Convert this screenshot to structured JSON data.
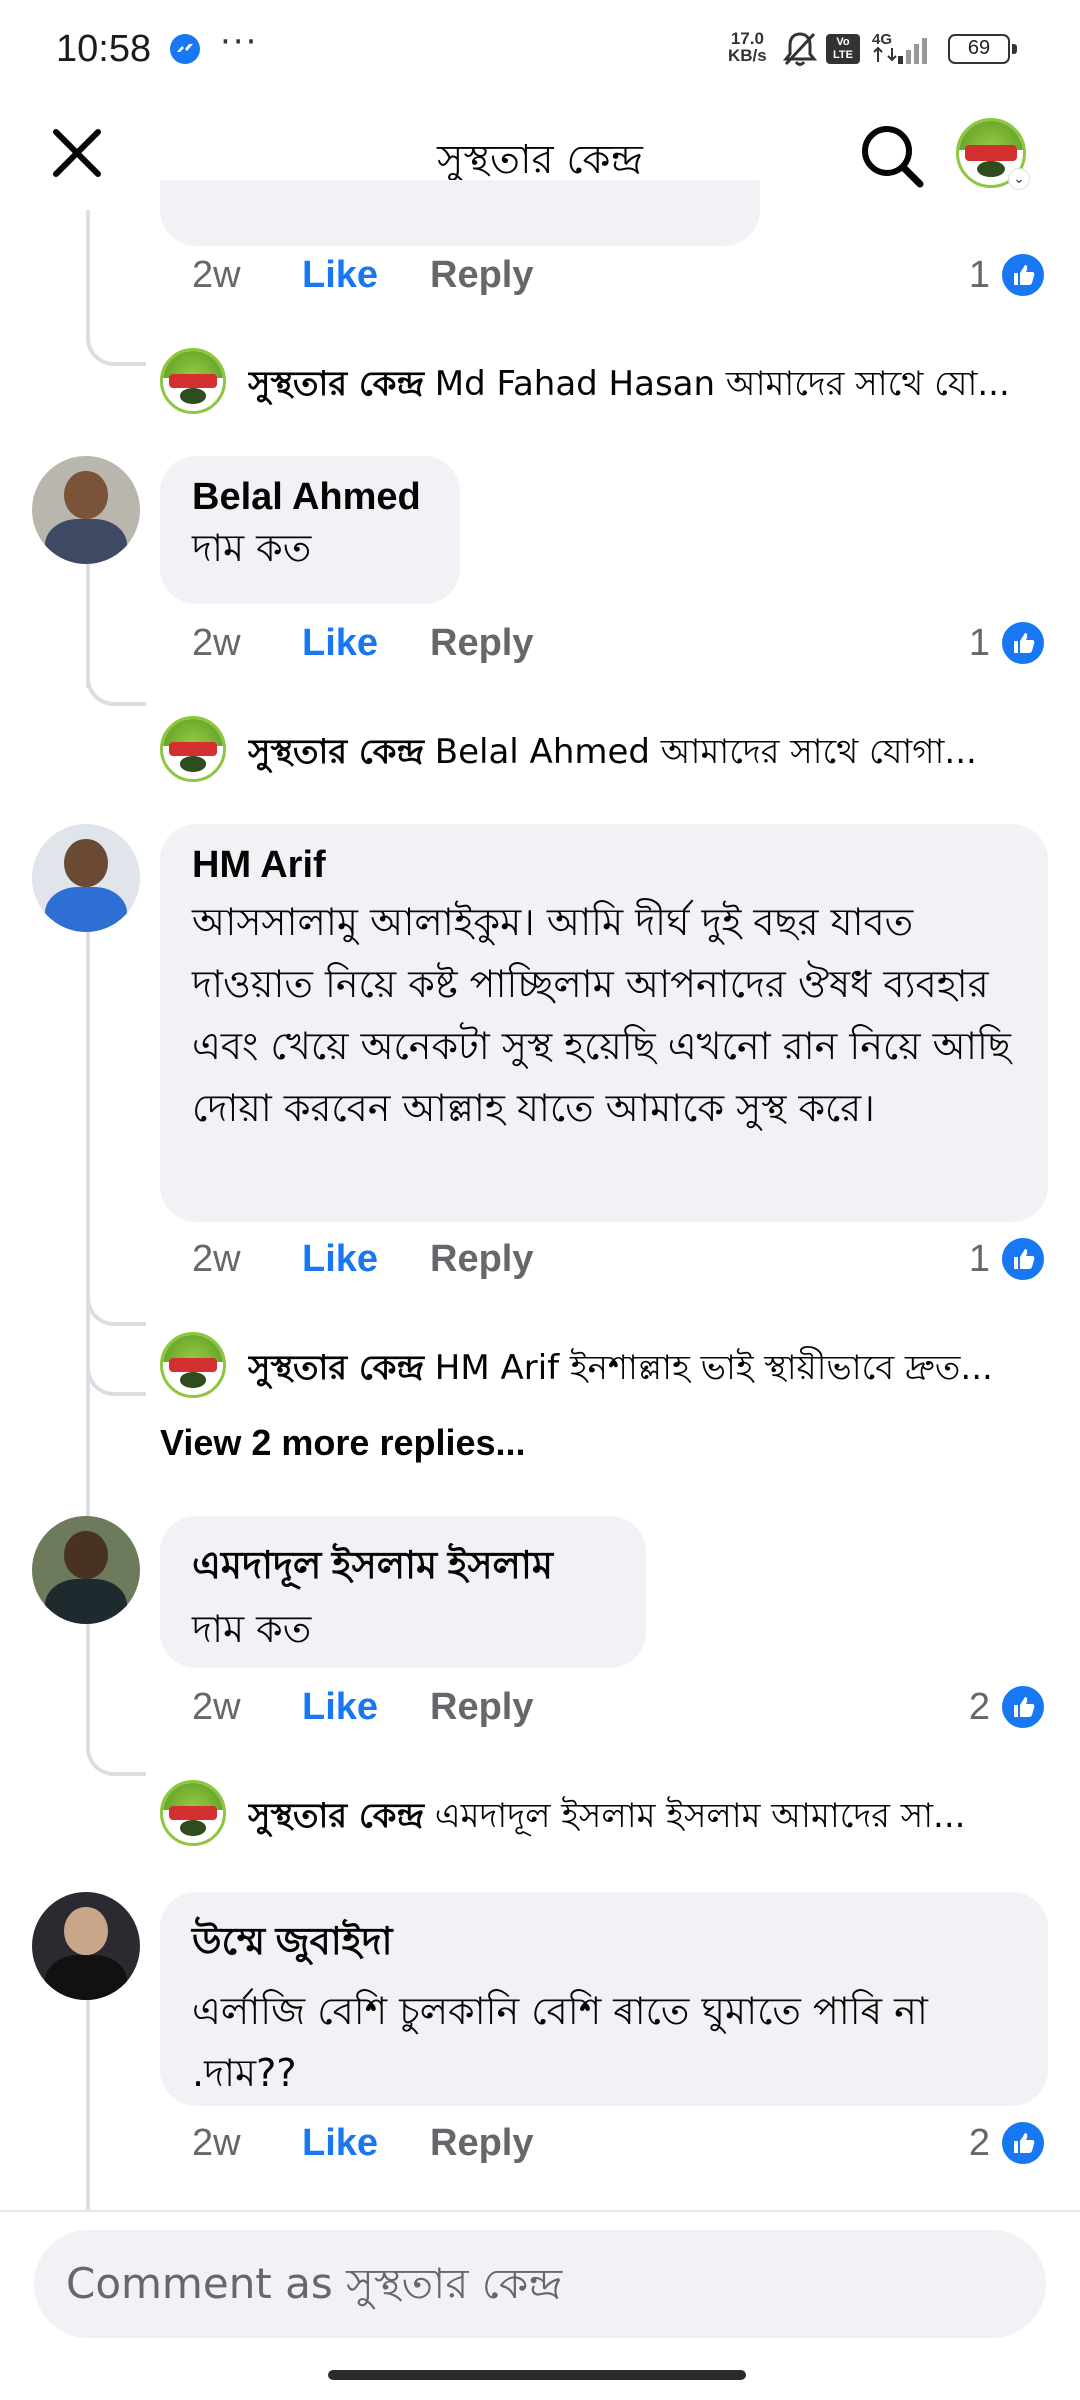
{
  "status_bar": {
    "time": "10:58",
    "more": "···",
    "net_speed_value": "17.0",
    "net_speed_unit": "KB/s",
    "volte": "Vo LTE",
    "network": "4G",
    "battery": "69"
  },
  "header": {
    "title": "সুস্থতার কেন্দ্র",
    "close_icon": "close-icon",
    "search_icon": "search-icon",
    "avatar_icon": "page-logo"
  },
  "thread": {
    "top_fragment": {
      "time": "2w",
      "like_label": "Like",
      "reply_label": "Reply",
      "reaction_count": "1",
      "page_reply": {
        "author": "সুস্থতার কেন্দ্র",
        "text": "Md Fahad Hasan আমাদের সাথে যো..."
      }
    },
    "comments": [
      {
        "author": "Belal Ahmed",
        "text": "দাম কত",
        "time": "2w",
        "like_label": "Like",
        "reply_label": "Reply",
        "reaction_count": "1",
        "page_reply": {
          "author": "সুস্থতার কেন্দ্র",
          "text": "Belal Ahmed আমাদের সাথে যোগা..."
        }
      },
      {
        "author": "HM Arif",
        "text": "আসসালামু আলাইকুম। আমি দীর্ঘ দুই বছর যাবত দাওয়াত নিয়ে কষ্ট পাচ্ছিলাম আপনাদের ঔষধ ব্যবহার এবং খেয়ে অনেকটা সুস্থ হয়েছি এখনো রান নিয়ে আছি দোয়া করবেন আল্লাহ যাতে আমাকে সুস্থ করে।",
        "time": "2w",
        "like_label": "Like",
        "reply_label": "Reply",
        "reaction_count": "1",
        "page_reply": {
          "author": "সুস্থতার কেন্দ্র",
          "text": "HM Arif ইনশাল্লাহ ভাই স্থায়ীভাবে দ্রুত..."
        },
        "more_replies": "View 2 more replies..."
      },
      {
        "author": "এমদাদূল ইসলাম ইসলাম",
        "text": "দাম কত",
        "time": "2w",
        "like_label": "Like",
        "reply_label": "Reply",
        "reaction_count": "2",
        "page_reply": {
          "author": "সুস্থতার কেন্দ্র",
          "text": "এমদাদূল ইসলাম ইসলাম আমাদের সা..."
        }
      },
      {
        "author": "উম্মে জুবাইদা",
        "text": "এর্লাজি বেশি চুলকানি বেশি ৰাতে ঘুমাতে পাৰি না .দাম??",
        "time": "2w",
        "like_label": "Like",
        "reply_label": "Reply",
        "reaction_count": "2"
      }
    ]
  },
  "composer": {
    "placeholder": "Comment as সুস্থতার কেন্দ্র"
  },
  "colors": {
    "accent": "#1877f2",
    "bubble": "#f0f2f5",
    "secondary_text": "#65676b",
    "thread_line": "#dadde1"
  }
}
